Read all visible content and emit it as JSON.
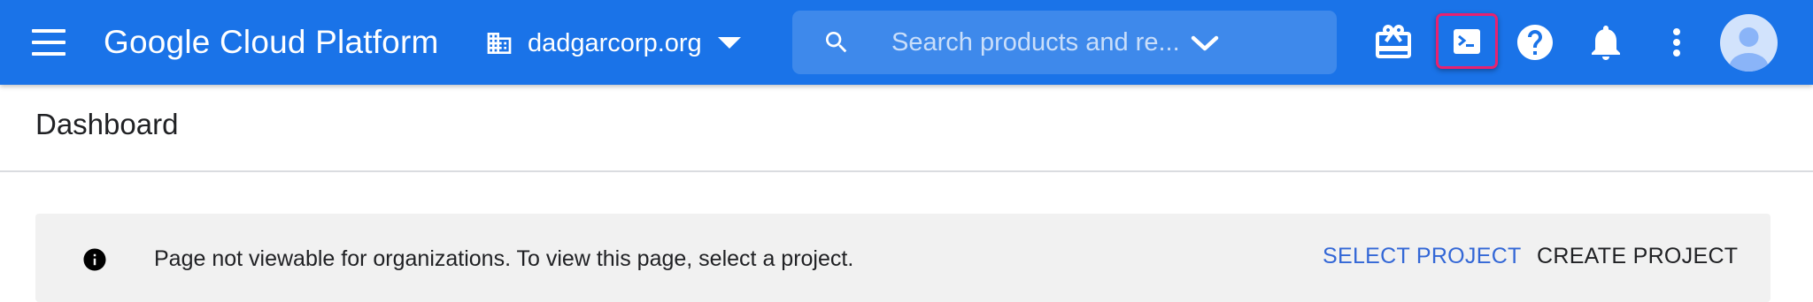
{
  "header": {
    "brand": "Google Cloud Platform",
    "organization": "dadgarcorp.org",
    "search": {
      "placeholder": "Search products and re..."
    },
    "icons": [
      "menu-icon",
      "organization-icon",
      "dropdown-caret-icon",
      "search-icon",
      "expand-chevron-icon",
      "gift-icon",
      "cloud-shell-icon",
      "help-icon",
      "notifications-icon",
      "more-vert-icon",
      "account-avatar"
    ],
    "colors": {
      "bar": "#1a73e8",
      "highlight_border": "#e8216f"
    }
  },
  "page": {
    "title": "Dashboard"
  },
  "banner": {
    "message": "Page not viewable for organizations. To view this page, select a project.",
    "select_project_label": "SELECT PROJECT",
    "create_project_label": "CREATE PROJECT",
    "colors": {
      "select_project": "#3367d6",
      "background": "#f1f1f1"
    }
  }
}
